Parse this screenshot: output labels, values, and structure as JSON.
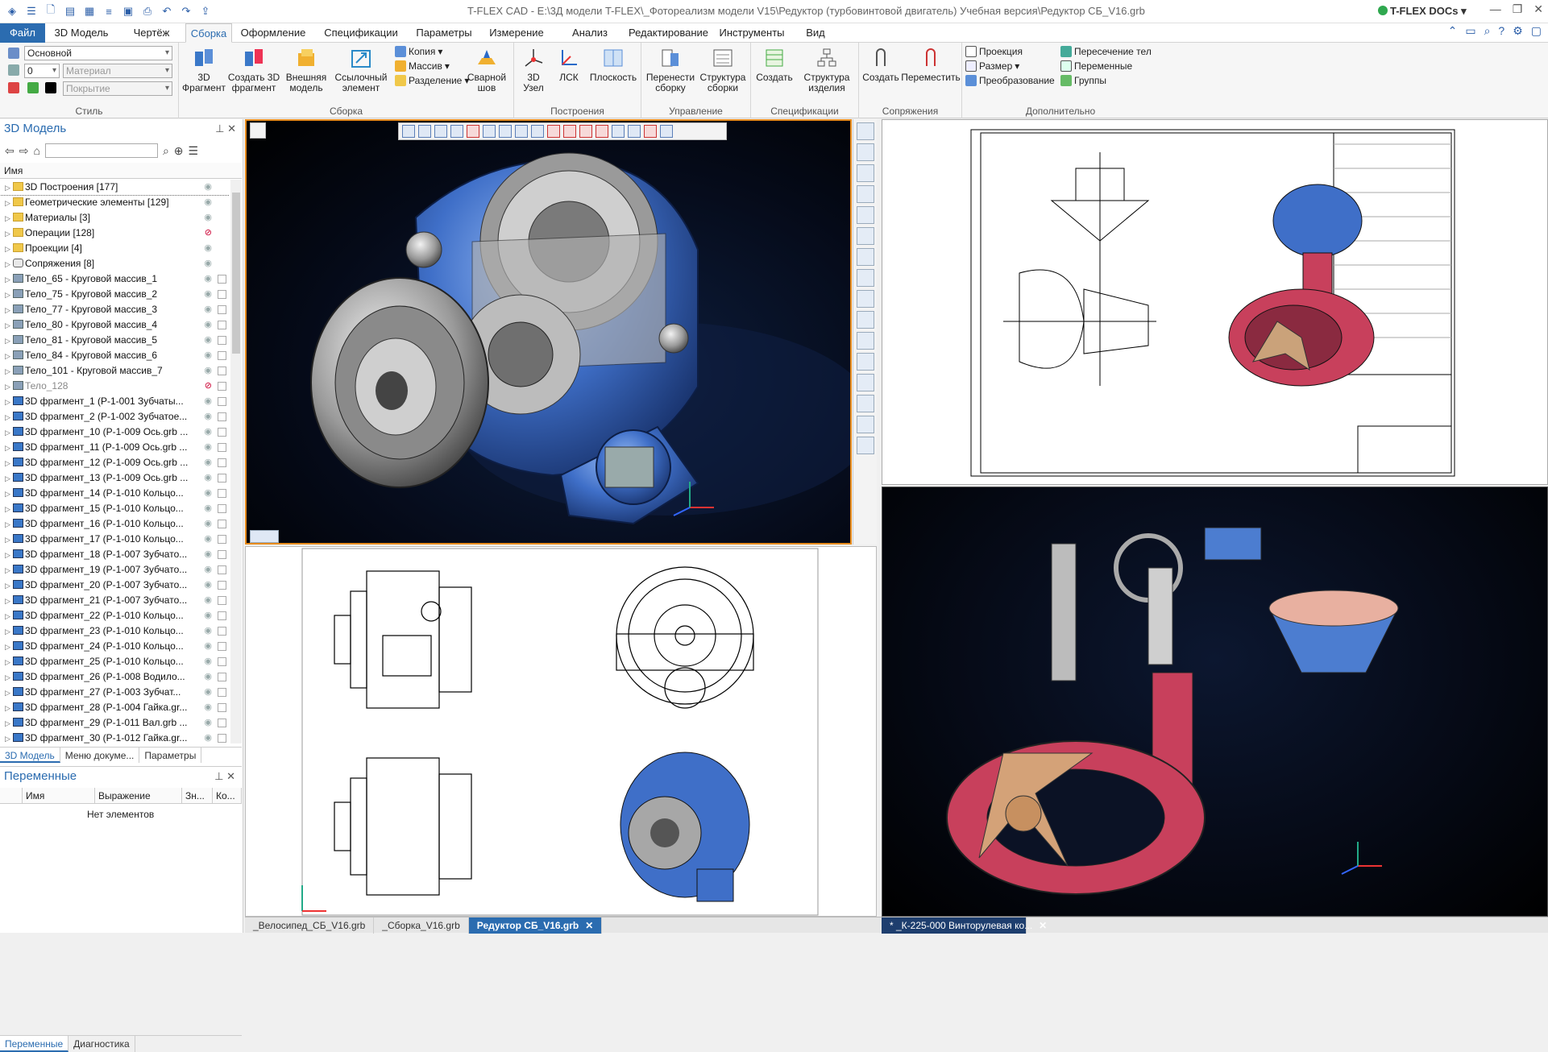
{
  "app": {
    "window_title": "T-FLEX CAD - E:\\3Д модели T-FLEX\\_Фотореализм модели V15\\Редуктор (турбовинтовой двигатель) Учебная версия\\Редуктор СБ_V16.grb",
    "docs_label": "T-FLEX DOCs"
  },
  "menu": {
    "tabs": [
      "Файл",
      "3D Модель",
      "Чертёж",
      "Сборка",
      "Оформление",
      "Спецификации",
      "Параметры",
      "Измерение",
      "Анализ",
      "Редактирование",
      "Инструменты",
      "Вид"
    ],
    "active": "Сборка"
  },
  "ribbon": {
    "style": {
      "name": "Стиль",
      "layer": "Основной",
      "level": "0",
      "material_placeholder": "Материал",
      "coating_placeholder": "Покрытие"
    },
    "assembly": {
      "name": "Сборка",
      "fragment": "3D\nФрагмент",
      "create_fragment": "Создать 3D\nфрагмент",
      "external_model": "Внешняя\nмодель",
      "ref_element": "Ссылочный\nэлемент",
      "copy": "Копия",
      "array": "Массив",
      "split": "Разделение",
      "weld": "Сварной\nшов"
    },
    "construction": {
      "name": "Построения",
      "node": "3D\nУзел",
      "lcs": "ЛСК",
      "plane": "Плоскость"
    },
    "management": {
      "name": "Управление",
      "move_assemblies": "Перенести\nсборку",
      "structure": "Структура\nсборки"
    },
    "specs": {
      "name": "Спецификации",
      "create": "Создать",
      "product_structure": "Структура\nизделия"
    },
    "mates": {
      "name": "Сопряжения",
      "create": "Создать",
      "move": "Переместить"
    },
    "extra": {
      "name": "Дополнительно",
      "projection": "Проекция",
      "dimension": "Размер",
      "transform": "Преобразование",
      "intersect": "Пересечение тел",
      "variables": "Переменные",
      "groups": "Группы"
    }
  },
  "model_panel": {
    "title": "3D Модель",
    "column": "Имя",
    "items": [
      {
        "label": "3D Построения [177]",
        "icon": "folder",
        "hidden": false
      },
      {
        "label": "Геометрические элементы [129]",
        "icon": "folder",
        "hidden": false
      },
      {
        "label": "Материалы [3]",
        "icon": "folder",
        "hidden": false
      },
      {
        "label": "Операции [128]",
        "icon": "folder",
        "hidden": true
      },
      {
        "label": "Проекции [4]",
        "icon": "folder",
        "hidden": false
      },
      {
        "label": "Сопряжения [8]",
        "icon": "conj",
        "hidden": false
      },
      {
        "label": "Тело_65 - Круговой массив_1",
        "icon": "body",
        "hidden": false
      },
      {
        "label": "Тело_75 - Круговой массив_2",
        "icon": "body",
        "hidden": false
      },
      {
        "label": "Тело_77 - Круговой массив_3",
        "icon": "body",
        "hidden": false
      },
      {
        "label": "Тело_80 - Круговой массив_4",
        "icon": "body",
        "hidden": false
      },
      {
        "label": "Тело_81 - Круговой массив_5",
        "icon": "body",
        "hidden": false
      },
      {
        "label": "Тело_84 - Круговой массив_6",
        "icon": "body",
        "hidden": false
      },
      {
        "label": "Тело_101 - Круговой массив_7",
        "icon": "body",
        "hidden": false
      },
      {
        "label": "Тело_128",
        "icon": "body",
        "hidden": true
      },
      {
        "label": "3D фрагмент_1 (Р-1-001 Зубчаты...",
        "icon": "frag",
        "hidden": false
      },
      {
        "label": "3D фрагмент_2 (Р-1-002 Зубчатое...",
        "icon": "frag",
        "hidden": false
      },
      {
        "label": "3D фрагмент_10 (Р-1-009 Ось.grb ...",
        "icon": "frag",
        "hidden": false
      },
      {
        "label": "3D фрагмент_11 (Р-1-009 Ось.grb ...",
        "icon": "frag",
        "hidden": false
      },
      {
        "label": "3D фрагмент_12 (Р-1-009 Ось.grb ...",
        "icon": "frag",
        "hidden": false
      },
      {
        "label": "3D фрагмент_13 (Р-1-009 Ось.grb ...",
        "icon": "frag",
        "hidden": false
      },
      {
        "label": "3D фрагмент_14 (Р-1-010 Кольцо...",
        "icon": "frag",
        "hidden": false
      },
      {
        "label": "3D фрагмент_15 (Р-1-010 Кольцо...",
        "icon": "frag",
        "hidden": false
      },
      {
        "label": "3D фрагмент_16 (Р-1-010 Кольцо...",
        "icon": "frag",
        "hidden": false
      },
      {
        "label": "3D фрагмент_17 (Р-1-010 Кольцо...",
        "icon": "frag",
        "hidden": false
      },
      {
        "label": "3D фрагмент_18 (Р-1-007 Зубчато...",
        "icon": "frag",
        "hidden": false
      },
      {
        "label": "3D фрагмент_19 (Р-1-007 Зубчато...",
        "icon": "frag",
        "hidden": false
      },
      {
        "label": "3D фрагмент_20 (Р-1-007 Зубчато...",
        "icon": "frag",
        "hidden": false
      },
      {
        "label": "3D фрагмент_21 (Р-1-007 Зубчато...",
        "icon": "frag",
        "hidden": false
      },
      {
        "label": "3D фрагмент_22 (Р-1-010 Кольцо...",
        "icon": "frag",
        "hidden": false
      },
      {
        "label": "3D фрагмент_23 (Р-1-010 Кольцо...",
        "icon": "frag",
        "hidden": false
      },
      {
        "label": "3D фрагмент_24 (Р-1-010 Кольцо...",
        "icon": "frag",
        "hidden": false
      },
      {
        "label": "3D фрагмент_25 (Р-1-010 Кольцо...",
        "icon": "frag",
        "hidden": false
      },
      {
        "label": "3D фрагмент_26 (Р-1-008 Водило...",
        "icon": "frag",
        "hidden": false
      },
      {
        "label": "3D фрагмент_27 (Р-1-003 Зубчат...",
        "icon": "frag",
        "hidden": false
      },
      {
        "label": "3D фрагмент_28 (Р-1-004 Гайка.gr...",
        "icon": "frag",
        "hidden": false
      },
      {
        "label": "3D фрагмент_29 (Р-1-011 Вал.grb ...",
        "icon": "frag",
        "hidden": false
      },
      {
        "label": "3D фрагмент_30 (Р-1-012 Гайка.gr...",
        "icon": "frag",
        "hidden": false
      }
    ],
    "tabs": [
      "3D Модель",
      "Меню докуме...",
      "Параметры"
    ]
  },
  "vars_panel": {
    "title": "Переменные",
    "columns": [
      "Имя",
      "Выражение",
      "Зн...",
      "Ко..."
    ],
    "empty": "Нет элементов",
    "tabs": [
      "Переменные",
      "Диагностика"
    ]
  },
  "documents": {
    "tabs": [
      "_Велосипед_СБ_V16.grb",
      "_Сборка_V16.grb",
      "Редуктор СБ_V16.grb"
    ],
    "active_tab": "Редуктор СБ_V16.grb",
    "right_tab": "*  _К-225-000 Винторулевая ко..."
  },
  "colors": {
    "accent": "#2b6cb0",
    "active_view_border": "#e88c1d",
    "housing_blue": "#3f6fc8",
    "body_red": "#c8405c"
  }
}
